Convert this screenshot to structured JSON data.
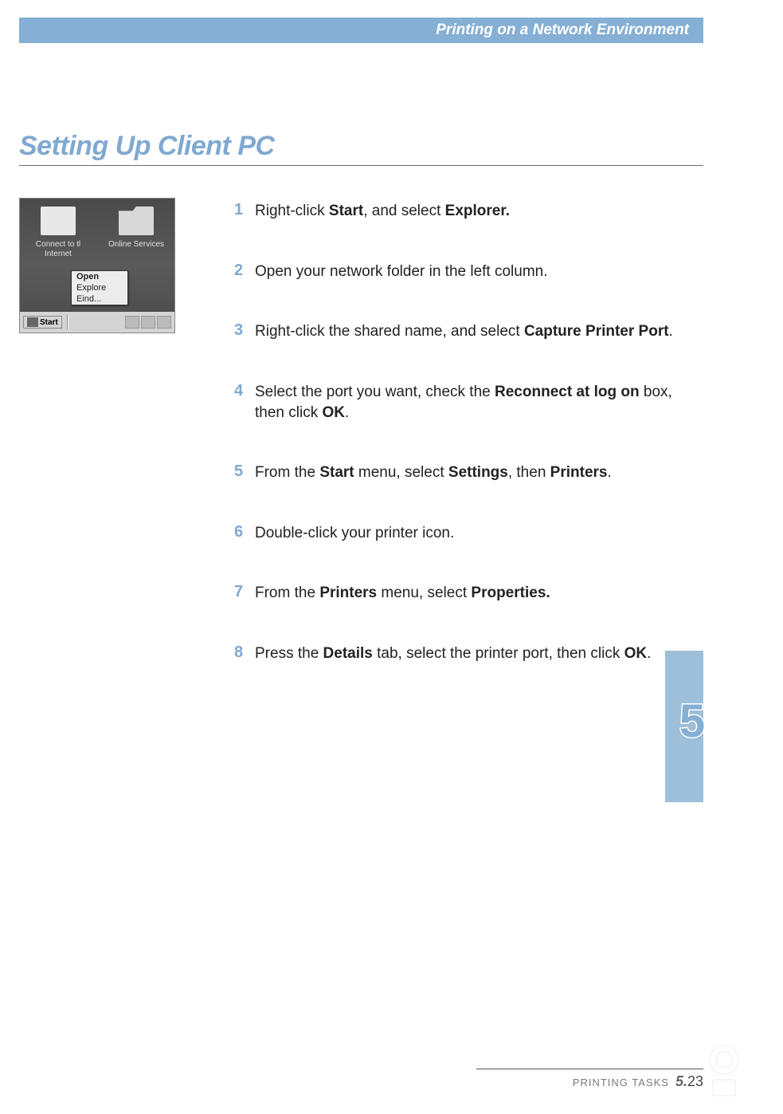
{
  "header": {
    "title": "Printing on a Network Environment"
  },
  "section": {
    "title": "Setting Up Client PC"
  },
  "screenshot": {
    "icons": [
      {
        "label": "Connect to tl Internet"
      },
      {
        "label": "Online Services"
      }
    ],
    "context_menu": [
      {
        "label": "Open"
      },
      {
        "label": "Explore"
      },
      {
        "label": "Eind..."
      }
    ],
    "taskbar": {
      "start": "Start"
    }
  },
  "steps": [
    {
      "num": "1",
      "text_parts": [
        {
          "t": "Right-click ",
          "b": false
        },
        {
          "t": "Start",
          "b": true
        },
        {
          "t": ", and select ",
          "b": false
        },
        {
          "t": "Explorer.",
          "b": true
        }
      ]
    },
    {
      "num": "2",
      "text_parts": [
        {
          "t": "Open your network folder in the left column.",
          "b": false
        }
      ]
    },
    {
      "num": "3",
      "text_parts": [
        {
          "t": "Right-click the shared name, and select ",
          "b": false
        },
        {
          "t": "Capture Printer Port",
          "b": true
        },
        {
          "t": ".",
          "b": false
        }
      ]
    },
    {
      "num": "4",
      "text_parts": [
        {
          "t": "Select the port you want, check the ",
          "b": false
        },
        {
          "t": "Reconnect at log on",
          "b": true
        },
        {
          "t": " box, then click ",
          "b": false
        },
        {
          "t": "OK",
          "b": true
        },
        {
          "t": ".",
          "b": false
        }
      ]
    },
    {
      "num": "5",
      "text_parts": [
        {
          "t": "From the ",
          "b": false
        },
        {
          "t": "Start",
          "b": true
        },
        {
          "t": " menu, select ",
          "b": false
        },
        {
          "t": "Settings",
          "b": true
        },
        {
          "t": ", then ",
          "b": false
        },
        {
          "t": "Printers",
          "b": true
        },
        {
          "t": ".",
          "b": false
        }
      ]
    },
    {
      "num": "6",
      "text_parts": [
        {
          "t": "Double-click your printer icon.",
          "b": false
        }
      ]
    },
    {
      "num": "7",
      "text_parts": [
        {
          "t": "From the ",
          "b": false
        },
        {
          "t": "Printers",
          "b": true
        },
        {
          "t": " menu, select ",
          "b": false
        },
        {
          "t": "Properties.",
          "b": true
        }
      ]
    },
    {
      "num": "8",
      "text_parts": [
        {
          "t": "Press the ",
          "b": false
        },
        {
          "t": "Details",
          "b": true
        },
        {
          "t": " tab, select the printer port, then click ",
          "b": false
        },
        {
          "t": "OK",
          "b": true
        },
        {
          "t": ".",
          "b": false
        }
      ]
    }
  ],
  "chapter": {
    "badge": "5"
  },
  "footer": {
    "label": "PRINTING TASKS",
    "chapter": "5.",
    "page": "23"
  }
}
